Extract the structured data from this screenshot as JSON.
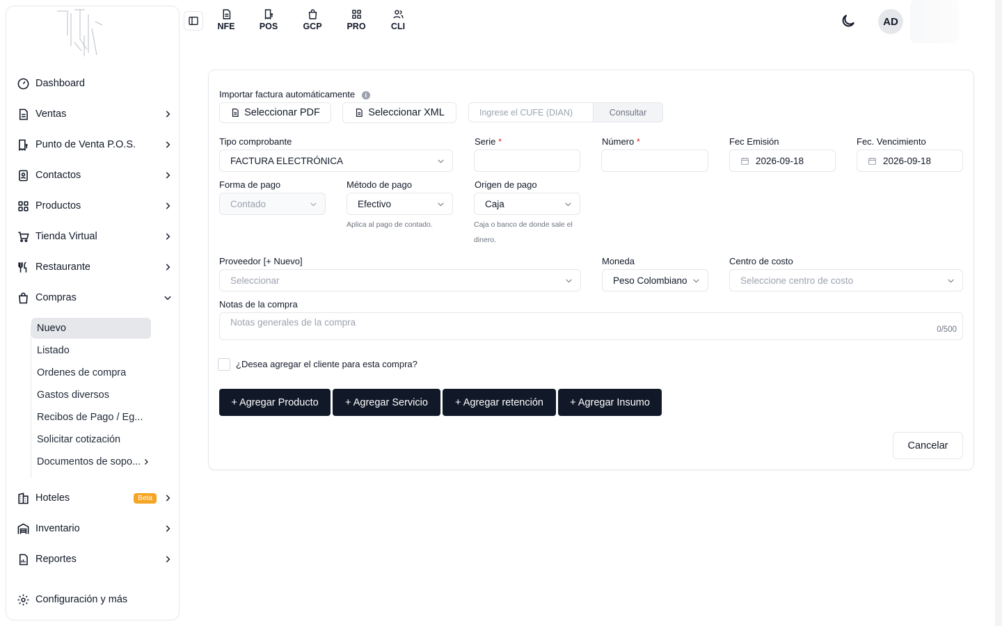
{
  "topbar": {
    "apps": [
      {
        "label": "NFE",
        "icon": "document-icon"
      },
      {
        "label": "POS",
        "icon": "receipt-dollar-icon"
      },
      {
        "label": "GCP",
        "icon": "shopping-bag-icon"
      },
      {
        "label": "PRO",
        "icon": "grid-icon"
      },
      {
        "label": "CLI",
        "icon": "users-icon"
      }
    ],
    "avatar_initials": "AD"
  },
  "sidebar": {
    "items": [
      {
        "label": "Dashboard"
      },
      {
        "label": "Ventas"
      },
      {
        "label": "Punto de Venta P.O.S."
      },
      {
        "label": "Contactos"
      },
      {
        "label": "Productos"
      },
      {
        "label": "Tienda Virtual"
      },
      {
        "label": "Restaurante"
      },
      {
        "label": "Compras"
      },
      {
        "label": "Hoteles",
        "badge": "Beta"
      },
      {
        "label": "Inventario"
      },
      {
        "label": "Reportes"
      },
      {
        "label": "Configuración y más"
      }
    ],
    "compras_sub": [
      {
        "label": "Nuevo"
      },
      {
        "label": "Listado"
      },
      {
        "label": "Ordenes de compra"
      },
      {
        "label": "Gastos diversos"
      },
      {
        "label": "Recibos de Pago / Eg..."
      },
      {
        "label": "Solicitar cotización"
      },
      {
        "label": "Documentos de sopo..."
      }
    ]
  },
  "form": {
    "import_label": "Importar factura automáticamente",
    "pdf_button": "Seleccionar PDF",
    "xml_button": "Seleccionar XML",
    "cufe_placeholder": "Ingrese el CUFE (DIAN)",
    "consult_button": "Consultar",
    "tipo_label": "Tipo comprobante",
    "tipo_value": "FACTURA ELECTRÓNICA",
    "serie_label": "Serie",
    "numero_label": "Número",
    "required_mark": "*",
    "fec_emision_label": "Fec Emisión",
    "fec_emision_value": "2026-09-18",
    "fec_venc_label": "Fec. Vencimiento",
    "fec_venc_value": "2026-09-18",
    "forma_pago_label": "Forma de pago",
    "forma_pago_value": "Contado",
    "metodo_pago_label": "Método de pago",
    "metodo_pago_value": "Efectivo",
    "metodo_pago_hint": "Aplica al pago de contado.",
    "origen_pago_label": "Origen de pago",
    "origen_pago_value": "Caja",
    "origen_pago_hint_1": "Caja o banco de donde sale el",
    "origen_pago_hint_2": "dinero.",
    "proveedor_label": "Proveedor [+ Nuevo]",
    "proveedor_placeholder": "Seleccionar",
    "moneda_label": "Moneda",
    "moneda_value": "Peso Colombiano",
    "centro_label": "Centro de costo",
    "centro_placeholder": "Seleccione centro de costo",
    "notas_label": "Notas de la compra",
    "notas_placeholder": "Notas generales de la compra",
    "notas_counter": "0/500",
    "cliente_checkbox_label": "¿Desea agregar el cliente para esta compra?",
    "add_producto": "+ Agregar Producto",
    "add_servicio": "+ Agregar Servicio",
    "add_retencion": "+ Agregar retención",
    "add_insumo": "+ Agregar Insumo",
    "cancel_button": "Cancelar"
  }
}
